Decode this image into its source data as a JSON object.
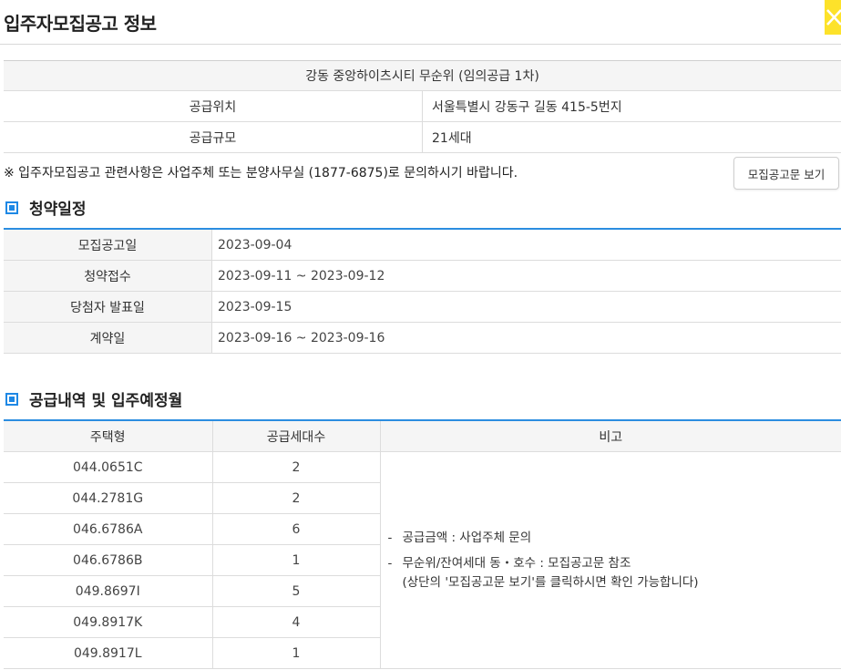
{
  "header": {
    "title": "입주자모집공고 정보"
  },
  "info": {
    "title": "강동 중앙하이츠시티 무순위 (임의공급 1차)",
    "rows": [
      {
        "label": "공급위치",
        "value": "서울특별시 강동구 길동 415-5번지"
      },
      {
        "label": "공급규모",
        "value": "21세대"
      }
    ]
  },
  "notice": {
    "text": "※ 입주자모집공고 관련사항은 사업주체 또는 분양사무실 (1877-6875)로 문의하시기 바랍니다.",
    "button_label": "모집공고문 보기"
  },
  "schedule": {
    "title": "청약일정",
    "rows": [
      {
        "label": "모집공고일",
        "value": "2023-09-04"
      },
      {
        "label": "청약접수",
        "value": "2023-09-11 ~ 2023-09-12"
      },
      {
        "label": "당첨자 발표일",
        "value": "2023-09-15"
      },
      {
        "label": "계약일",
        "value": "2023-09-16 ~ 2023-09-16"
      }
    ]
  },
  "supply": {
    "title": "공급내역 및 입주예정월",
    "headers": [
      "주택형",
      "공급세대수",
      "비고"
    ],
    "rows": [
      {
        "type": "044.0651C",
        "count": "2"
      },
      {
        "type": "044.2781G",
        "count": "2"
      },
      {
        "type": "046.6786A",
        "count": "6"
      },
      {
        "type": "046.6786B",
        "count": "1"
      },
      {
        "type": "049.8697I",
        "count": "5"
      },
      {
        "type": "049.8917K",
        "count": "4"
      },
      {
        "type": "049.8917L",
        "count": "1"
      }
    ],
    "remarks": {
      "line1": "공급금액 : 사업주체 문의",
      "line2": "무순위/잔여세대 동・호수 : 모집공고문 참조",
      "line3": "(상단의 '모집공고문 보기'를 클릭하시면 확인 가능합니다)",
      "dash": "-"
    }
  }
}
